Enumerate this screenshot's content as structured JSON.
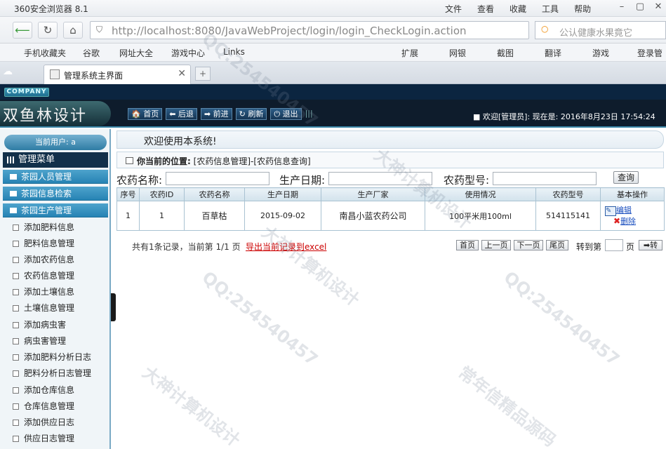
{
  "browser": {
    "title": "360安全浏览器 8.1",
    "menus": [
      "文件",
      "查看",
      "收藏",
      "工具",
      "帮助"
    ],
    "url_host": "http://localhost",
    "url_path": ":8080/JavaWebProject/login/login_CheckLogin.action",
    "search_placeholder": "公认健康水果竟它",
    "favorites": [
      "手机收藏夹",
      "谷歌",
      "网址大全",
      "游戏中心",
      "Links"
    ],
    "toolbar_right": [
      "扩展",
      "网银",
      "截图",
      "翻译",
      "游戏",
      "登录管"
    ],
    "tab_title": "管理系统主界面"
  },
  "header": {
    "company": "COMPANY",
    "logo_text": "双鱼林设计",
    "nav": [
      "首页",
      "后退",
      "前进",
      "刷新",
      "退出"
    ],
    "welcome": "■ 欢迎[管理员]:  现在是: 2016年8月23日 17:54:24"
  },
  "sidebar": {
    "current_user": "当前用户: a",
    "menu_title": "管理菜单",
    "categories": [
      "茶园人员管理",
      "茶园信息检索",
      "茶园生产管理"
    ],
    "items": [
      "添加肥料信息",
      "肥料信息管理",
      "添加农药信息",
      "农药信息管理",
      "添加土壤信息",
      "土壤信息管理",
      "添加病虫害",
      "病虫害管理",
      "添加肥料分析日志",
      "肥料分析日志管理",
      "添加仓库信息",
      "仓库信息管理",
      "添加供应日志",
      "供应日志管理"
    ]
  },
  "main": {
    "welcome_text": "欢迎使用本系统!",
    "location_label": "你当前的位置:",
    "location_path": "[农药信息管理]-[农药信息查询]",
    "search": {
      "name_label": "农药名称:",
      "date_label": "生产日期:",
      "model_label": "农药型号:",
      "query_button": "查询"
    },
    "table": {
      "headers": [
        "序号",
        "农药ID",
        "农药名称",
        "生产日期",
        "生产厂家",
        "使用情况",
        "农药型号",
        "基本操作"
      ],
      "rows": [
        [
          "1",
          "1",
          "百草枯",
          "2015-09-02",
          "南昌小蓝农药公司",
          "100平米用100ml",
          "514115141"
        ]
      ],
      "edit_label": "编辑",
      "delete_label": "删除"
    },
    "pager": {
      "info": "共有1条记录，当前第 1/1 页",
      "export": "导出当前记录到excel",
      "buttons": [
        "首页",
        "上一页",
        "下一页",
        "尾页"
      ],
      "goto_label": "转到第",
      "page_unit": "页",
      "goto_button": "➡转"
    }
  },
  "watermarks": [
    "QQ:254540457",
    "大神计算机设计",
    "常年信精品源码"
  ]
}
